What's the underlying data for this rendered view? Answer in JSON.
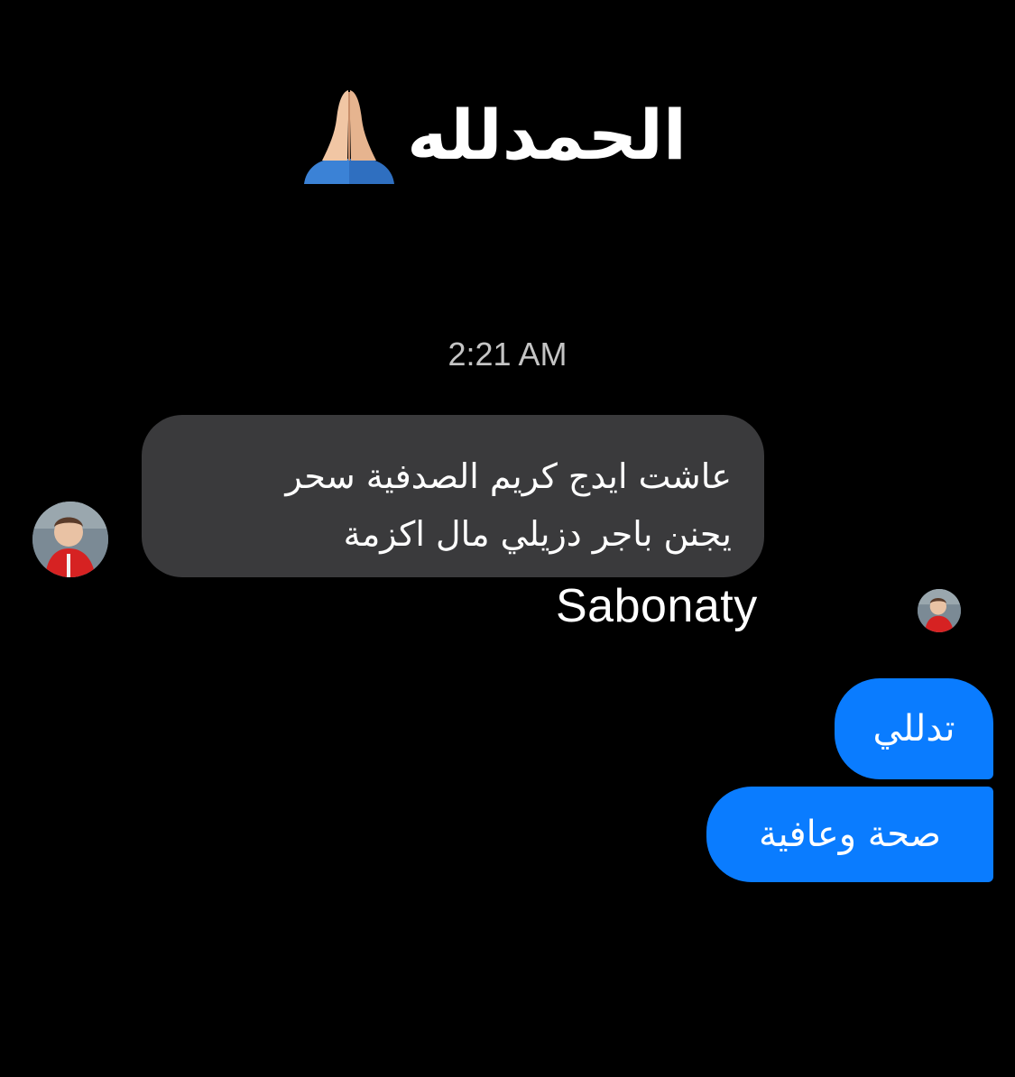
{
  "overlay": {
    "title": "الحمدلله",
    "emoji": "folded-hands-icon"
  },
  "conversation": {
    "timestamp": "2:21 AM",
    "incoming": {
      "lines": [
        "عاشت ايدج كريم الصدفية سحر",
        "يجنن باجر دزيلي مال اكزمة"
      ],
      "avatar": "contact-avatar"
    },
    "sender_name": "Sabonaty",
    "outgoing": [
      {
        "text": "تدللي"
      },
      {
        "text": "صحة وعافية"
      }
    ]
  },
  "colors": {
    "background": "#000000",
    "incoming_bubble": "#3a3a3c",
    "outgoing_bubble": "#0a7cff",
    "timestamp_text": "#c4c4c4"
  }
}
